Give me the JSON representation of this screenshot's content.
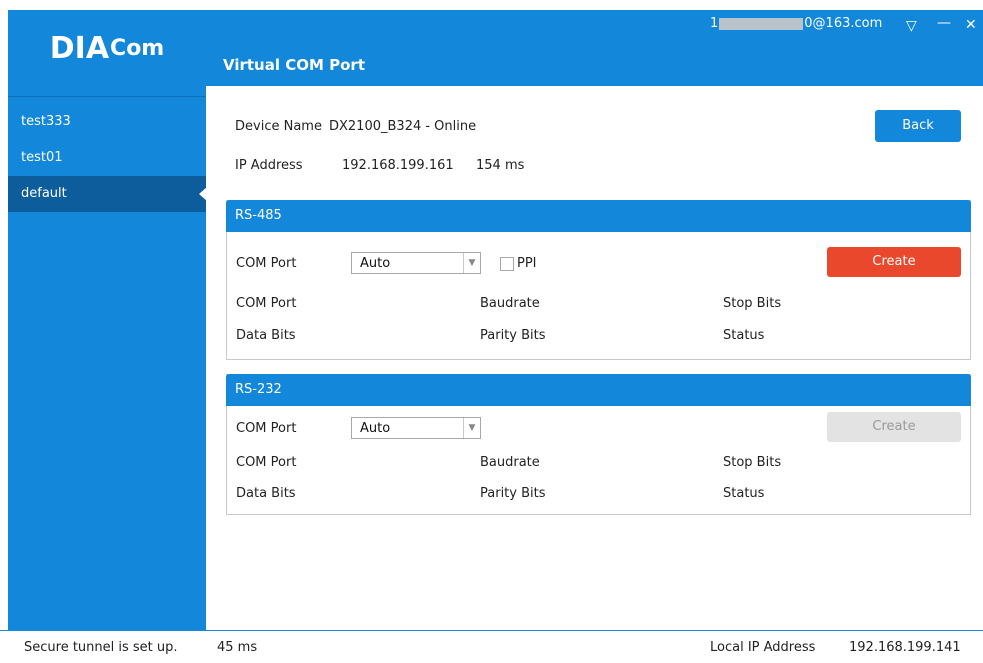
{
  "colors": {
    "brand_blue": "#1387d9",
    "active_sidebar": "#0d5d9c",
    "create_red": "#e9482c",
    "disabled_gray": "#e3e3e3"
  },
  "logo": {
    "big": "DIA",
    "small": "Com"
  },
  "header": {
    "title": "Virtual COM Port",
    "account_prefix": "1",
    "account_suffix": "0@163.com",
    "icons": [
      "dropdown-triangle-icon",
      "minimize-icon",
      "close-icon"
    ],
    "minimize_glyph": "—",
    "close_glyph": "✕",
    "dropdown_glyph": "▽"
  },
  "sidebar": {
    "items": [
      {
        "label": "test333"
      },
      {
        "label": "test01"
      },
      {
        "label": "default"
      }
    ],
    "active_index": 2
  },
  "device": {
    "name_label": "Device Name",
    "name_value": "DX2100_B324 - Online",
    "ip_label": "IP Address",
    "ip_value": "192.168.199.161",
    "latency": "154 ms",
    "back_label": "Back"
  },
  "panels": [
    {
      "title": "RS-485",
      "com_port_label": "COM Port",
      "select_value": "Auto",
      "ppi_label": "PPI",
      "ppi_checked": false,
      "create_label": "Create",
      "create_enabled": true,
      "fields": {
        "com_port": "COM Port",
        "baudrate": "Baudrate",
        "stop_bits": "Stop Bits",
        "data_bits": "Data Bits",
        "parity_bits": "Parity Bits",
        "status": "Status"
      }
    },
    {
      "title": "RS-232",
      "com_port_label": "COM Port",
      "select_value": "Auto",
      "create_label": "Create",
      "create_enabled": false,
      "fields": {
        "com_port": "COM Port",
        "baudrate": "Baudrate",
        "stop_bits": "Stop Bits",
        "data_bits": "Data Bits",
        "parity_bits": "Parity Bits",
        "status": "Status"
      }
    }
  ],
  "statusbar": {
    "tunnel_text": "Secure tunnel is set up.",
    "tunnel_latency": "45 ms",
    "local_ip_label": "Local IP Address",
    "local_ip_value": "192.168.199.141"
  }
}
